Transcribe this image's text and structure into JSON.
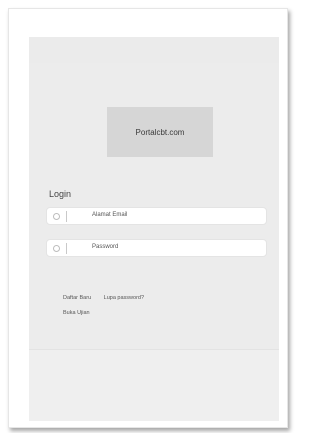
{
  "logo": {
    "text": "Portalcbt.com"
  },
  "form": {
    "heading": "Login",
    "email_placeholder": "Alamat Email",
    "password_placeholder": "Password"
  },
  "links": {
    "register": "Daftar Baru",
    "forgot": "Lupa password?",
    "exam": "Buka Ujian"
  }
}
